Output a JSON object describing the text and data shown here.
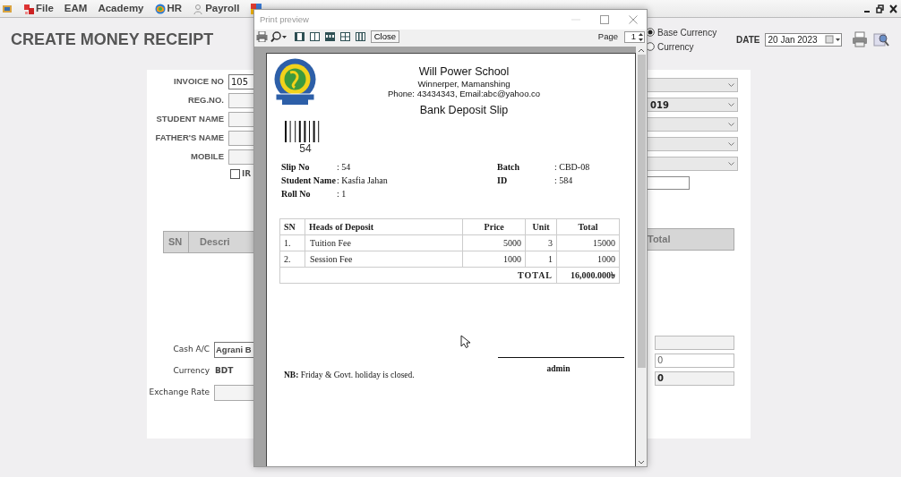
{
  "menu": [
    {
      "label": "File"
    },
    {
      "label": "EAM"
    },
    {
      "label": "Academy"
    },
    {
      "label": "HR"
    },
    {
      "label": "Payroll"
    }
  ],
  "page_title": "CREATE MONEY RECEIPT",
  "currency_options": [
    {
      "label": "Base Currency",
      "selected": true
    },
    {
      "label": "Currency",
      "selected": false
    }
  ],
  "date": {
    "label": "DATE",
    "value": "20 Jan 2023"
  },
  "form_left": [
    {
      "label": "INVOICE NO",
      "value": "105"
    },
    {
      "label": "REG.NO."
    },
    {
      "label": "STUDENT NAME"
    },
    {
      "label": "FATHER'S NAME"
    },
    {
      "label": "MOBILE"
    }
  ],
  "checkbox": {
    "label": "IR",
    "checked": false
  },
  "form_right": [
    {
      "kind": "select"
    },
    {
      "kind": "select",
      "value": "019"
    },
    {
      "kind": "select"
    },
    {
      "kind": "select"
    },
    {
      "kind": "select"
    },
    {
      "kind": "text"
    }
  ],
  "items_table": {
    "columns_left": [
      "SN",
      "Descri"
    ],
    "columns_right": [
      "Total"
    ]
  },
  "bottom_left": [
    {
      "label": "Cash A/C",
      "kind": "field",
      "value": "Agrani B"
    },
    {
      "label": "Currency",
      "kind": "text",
      "value": "BDT"
    },
    {
      "label": "Exchange Rate",
      "kind": "field"
    }
  ],
  "bottom_right": [
    {
      "kind": "readonly"
    },
    {
      "kind": "input",
      "value": "0"
    },
    {
      "kind": "total",
      "value": "0"
    }
  ],
  "print_preview": {
    "title": "Print preview",
    "close_button": "Close",
    "page_label": "Page",
    "page_value": "1",
    "document": {
      "school_name": "Will Power School",
      "address": "Winnerper, Mamanshing",
      "contact": "Phone: 43434343, Email:abc@yahoo.co",
      "slip_title": "Bank Deposit Slip",
      "barcode_number": "54",
      "info_left": [
        {
          "label": "Slip No",
          "value": ": 54"
        },
        {
          "label": "Student Name",
          "value": ": Kasfia Jahan"
        },
        {
          "label": "Roll No",
          "value": ": 1"
        }
      ],
      "info_right": [
        {
          "label": "Batch",
          "value": ": CBD-08"
        },
        {
          "label": "ID",
          "value": ": 584"
        }
      ],
      "columns": [
        "SN",
        "Heads of Deposit",
        "Price",
        "Unit",
        "Total"
      ],
      "rows": [
        [
          "1.",
          "Tuition Fee",
          "5000",
          "3",
          "15000"
        ],
        [
          "2.",
          "Session Fee",
          "1000",
          "1",
          "1000"
        ]
      ],
      "total_label": "TOTAL",
      "total_value": "16,000.000৳",
      "signature": "admin",
      "note": "**NB:** Friday & Govt. holiday is closed."
    }
  }
}
